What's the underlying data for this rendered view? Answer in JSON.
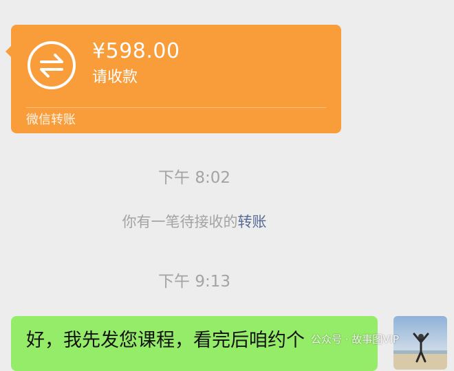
{
  "transfer": {
    "amount": "¥598.00",
    "status": "请收款",
    "footer": "微信转账",
    "icon": "transfer-arrows-icon",
    "color": "#f99d3b"
  },
  "timestamps": [
    "下午 8:02",
    "下午 9:13"
  ],
  "system_message": {
    "text": "你有一笔待接收的",
    "link": "转账",
    "link_color": "#576b95"
  },
  "outgoing_message": {
    "text": "好，我先发您课程，看完后咱约个",
    "color": "#95ec69"
  },
  "watermark": "公众号 · 故事图VIP"
}
